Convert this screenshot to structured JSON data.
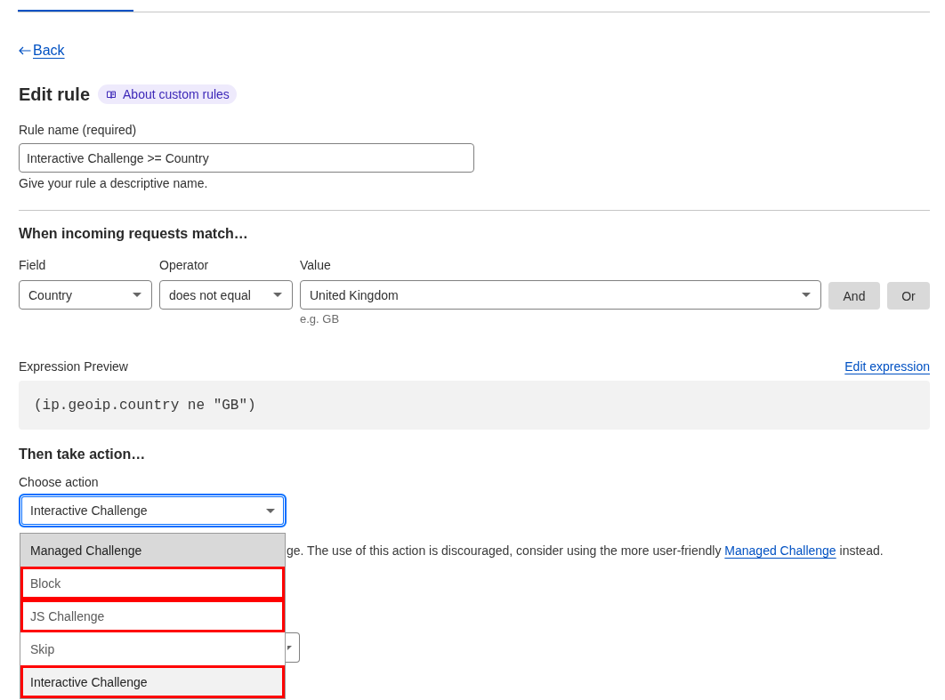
{
  "back_link": {
    "label": "Back"
  },
  "header": {
    "title": "Edit rule",
    "docs_link": "About custom rules"
  },
  "rule_name": {
    "label": "Rule name (required)",
    "value": "Interactive Challenge >= Country",
    "help": "Give your rule a descriptive name."
  },
  "match_section": {
    "title": "When incoming requests match…",
    "fields": [
      {
        "label": "Field",
        "value": "Country"
      },
      {
        "label": "Operator",
        "value": "does not equal"
      },
      {
        "label": "Value",
        "value": "United Kingdom",
        "hint": "e.g. GB"
      }
    ],
    "buttons": [
      "And",
      "Or"
    ]
  },
  "expression_preview": {
    "label": "Expression Preview",
    "edit_link": "Edit expression",
    "code": "(ip.geoip.country ne \"GB\")"
  },
  "action_section": {
    "title": "Then take action…",
    "label": "Choose action",
    "value": "Interactive Challenge",
    "focused": true,
    "description": {
      "text_before": "ge. The use of this action is discouraged, consider using the more user-friendly",
      "link": "Managed Challenge",
      "text_after": "instead."
    },
    "menu": [
      {
        "label": "Managed Challenge",
        "selected": false,
        "hovered": true,
        "annotated": false
      },
      {
        "label": "Block",
        "selected": false,
        "hovered": false,
        "annotated": true
      },
      {
        "label": "JS Challenge",
        "selected": false,
        "hovered": false,
        "annotated": true
      },
      {
        "label": "Skip",
        "selected": false,
        "hovered": false,
        "annotated": false
      },
      {
        "label": "Interactive Challenge",
        "selected": true,
        "hovered": false,
        "annotated": true
      }
    ]
  }
}
